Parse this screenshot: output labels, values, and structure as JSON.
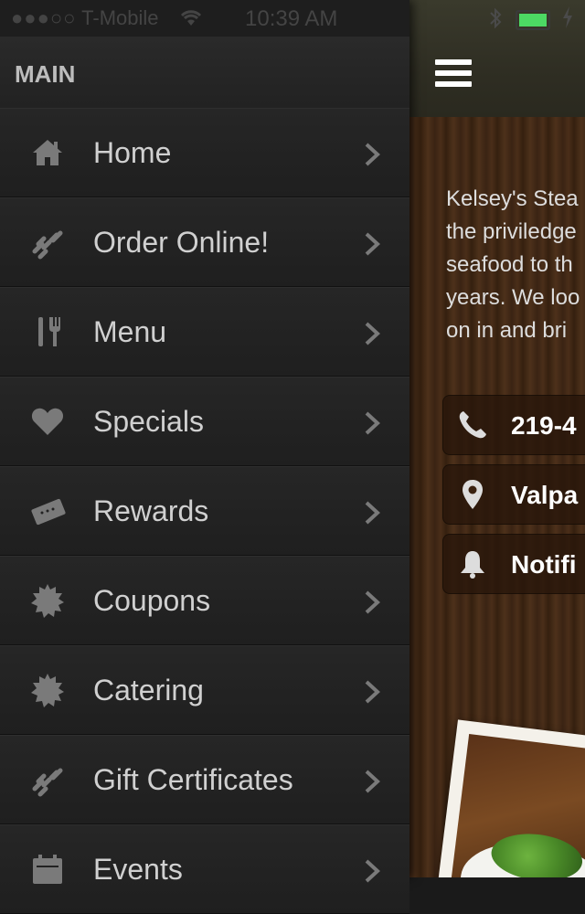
{
  "status_bar": {
    "signal": "●●●○○",
    "carrier": "T-Mobile",
    "time": "10:39 AM"
  },
  "drawer": {
    "section_title": "MAIN",
    "items": [
      {
        "label": "Home",
        "icon": "home-icon"
      },
      {
        "label": "Order Online!",
        "icon": "link-icon"
      },
      {
        "label": "Menu",
        "icon": "fork-knife-icon"
      },
      {
        "label": "Specials",
        "icon": "heart-icon"
      },
      {
        "label": "Rewards",
        "icon": "ticket-icon"
      },
      {
        "label": "Coupons",
        "icon": "starburst-icon"
      },
      {
        "label": "Catering",
        "icon": "starburst-icon"
      },
      {
        "label": "Gift Certificates",
        "icon": "link-icon"
      },
      {
        "label": "Events",
        "icon": "calendar-icon"
      }
    ]
  },
  "app": {
    "description_lines": [
      "Kelsey's Stea",
      "the priviledge",
      "seafood to th",
      "years. We loo",
      "on in and bri"
    ],
    "buttons": {
      "phone": "219-4",
      "location": "Valpa",
      "notifications": "Notifi"
    }
  },
  "colors": {
    "drawer_bg": "#1e1e1e",
    "battery": "#4cd964",
    "text": "#d0d0d0"
  }
}
